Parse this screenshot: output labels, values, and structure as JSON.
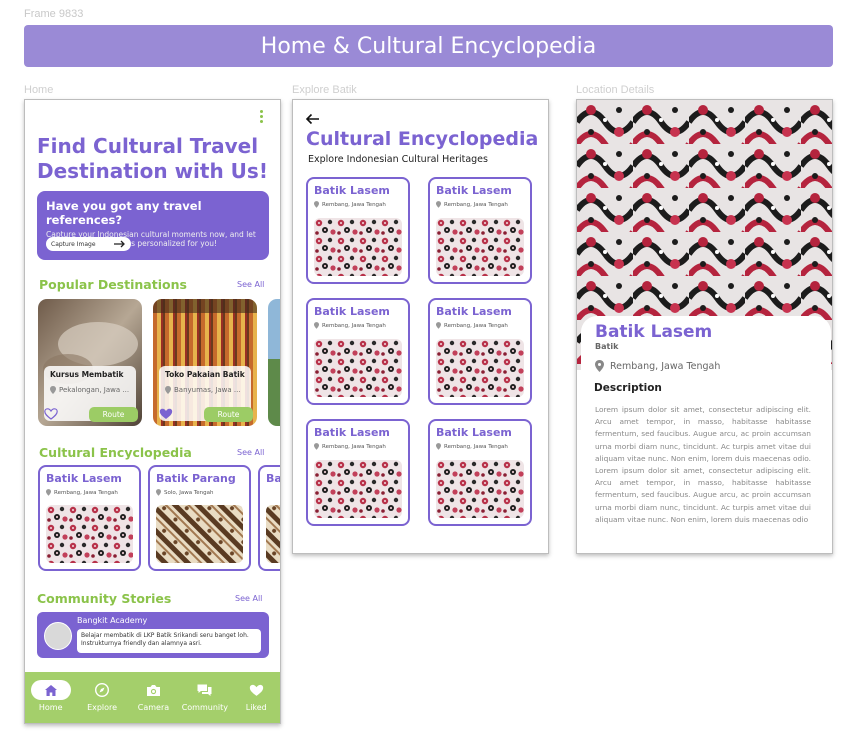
{
  "frame_label": "Frame 9833",
  "banner_title": "Home & Cultural Encyclopedia",
  "screens": {
    "home_label": "Home",
    "explore_label": "Explore Batik",
    "details_label": "Location Details"
  },
  "home": {
    "title": "Find Cultural Travel Destination with Us!",
    "travel_card": {
      "title": "Have you got any travel references?",
      "body": "Capture your Indonesian cultural moments now, and let us suggest destinations personalized for you!",
      "button": "Capture Image"
    },
    "popular": {
      "title": "Popular Destinations",
      "see_all": "See All",
      "items": [
        {
          "name": "Kursus Membatik",
          "location": "Pekalongan, Jawa ...",
          "route": "Route",
          "liked": false
        },
        {
          "name": "Toko Pakaian Batik",
          "location": "Banyumas, Jawa ...",
          "route": "Route",
          "liked": true
        }
      ]
    },
    "encyclopedia": {
      "title": "Cultural Encyclopedia",
      "see_all": "See All",
      "items": [
        {
          "name": "Batik Lasem",
          "location": "Rembang, Jawa Tengah"
        },
        {
          "name": "Batik Parang",
          "location": "Solo, Jawa Tengah"
        },
        {
          "name": "Ba"
        }
      ]
    },
    "stories": {
      "title": "Community Stories",
      "see_all": "See All",
      "item": {
        "author": "Bangkit Academy",
        "text": "Belajar membatik di LKP Batik Srikandi seru banget loh. Instrukturnya friendly dan alamnya asri."
      }
    },
    "nav": [
      {
        "label": "Home",
        "icon": "home-icon",
        "active": true
      },
      {
        "label": "Explore",
        "icon": "compass-icon",
        "active": false
      },
      {
        "label": "Camera",
        "icon": "camera-icon",
        "active": false
      },
      {
        "label": "Community",
        "icon": "chat-icon",
        "active": false
      },
      {
        "label": "Liked",
        "icon": "heart-icon",
        "active": false
      }
    ]
  },
  "explore": {
    "title": "Cultural Encyclopedia",
    "subtitle": "Explore Indonesian Cultural Heritages",
    "items": [
      {
        "name": "Batik Lasem",
        "location": "Rembang, Jawa Tengah"
      },
      {
        "name": "Batik Lasem",
        "location": "Rembang, Jawa Tengah"
      },
      {
        "name": "Batik Lasem",
        "location": "Rembang, Jawa Tengah"
      },
      {
        "name": "Batik Lasem",
        "location": "Rembang, Jawa Tengah"
      },
      {
        "name": "Batik Lasem",
        "location": "Rembang, Jawa Tengah"
      },
      {
        "name": "Batik Lasem",
        "location": "Rembang, Jawa Tengah"
      }
    ]
  },
  "details": {
    "title": "Batik Lasem",
    "kind": "Batik",
    "location": "Rembang, Jawa Tengah",
    "description_heading": "Description",
    "description": "Lorem ipsum dolor sit amet, consectetur adipiscing elit. Arcu amet tempor, in masso, habitasse habitasse fermentum, sed faucibus. Augue arcu, ac proin accumsan urna morbi diam nunc, tincidunt. Ac turpis amet vitae dui aliquam vitae nunc. Non enim, lorem duis maecenas odio. Lorem ipsum dolor sit amet, consectetur adipiscing elit. Arcu amet tempor, in masso, habitasse habitasse fermentum, sed faucibus. Augue arcu, ac proin accumsan urna morbi diam nunc, tincidunt. Ac turpis amet vitae dui aliquam vitae nunc. Non enim, lorem duis maecenas odio"
  },
  "colors": {
    "primary": "#7b63d1",
    "accent_green": "#8bc34a",
    "banner": "#9a8ad6",
    "nav_bar": "#a4cf6b"
  }
}
